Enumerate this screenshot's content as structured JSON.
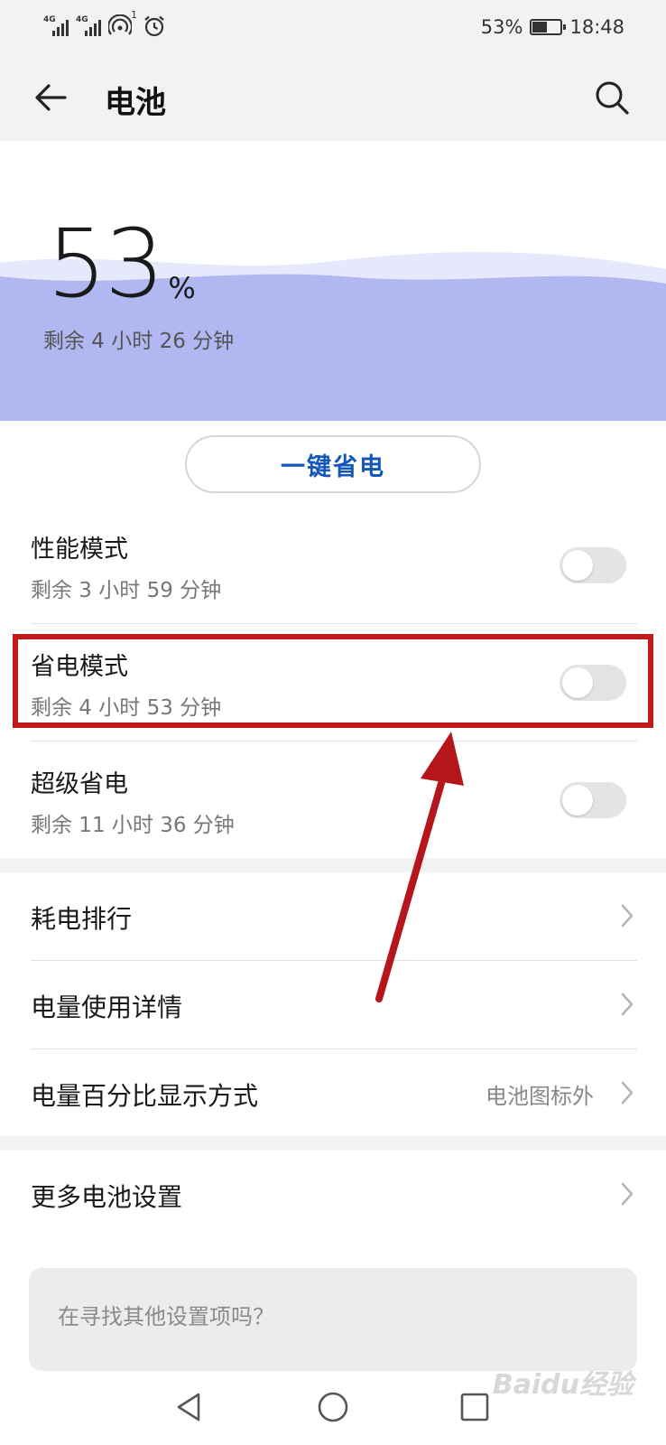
{
  "status_bar": {
    "network_1": "4G",
    "network_2": "4G",
    "hotspot_badge": "1",
    "battery_text": "53%",
    "time": "18:48",
    "battery_level": 0.53,
    "icons": [
      "signal-icon",
      "signal-icon",
      "hotspot-icon",
      "alarm-icon",
      "battery-icon"
    ]
  },
  "header": {
    "title": "电池",
    "back_icon": "back-arrow-icon",
    "search_icon": "search-icon"
  },
  "battery": {
    "percent": "53",
    "percent_sign": "%",
    "remaining": "剩余 4 小时 26 分钟",
    "wave_color": "#b1b7f0"
  },
  "one_key_save": {
    "label": "一键省电"
  },
  "modes": [
    {
      "title": "性能模式",
      "remaining": "剩余 3 小时 59 分钟",
      "enabled": false
    },
    {
      "title": "省电模式",
      "remaining": "剩余 4 小时 53 分钟",
      "enabled": false
    },
    {
      "title": "超级省电",
      "remaining": "剩余 11 小时 36 分钟",
      "enabled": false
    }
  ],
  "settings_list": [
    {
      "title": "耗电排行",
      "value": ""
    },
    {
      "title": "电量使用详情",
      "value": ""
    },
    {
      "title": "电量百分比显示方式",
      "value": "电池图标外"
    }
  ],
  "more": {
    "title": "更多电池设置"
  },
  "search_card": {
    "text": "在寻找其他设置项吗？"
  },
  "nav_bar": {
    "back_icon": "triangle-back-icon",
    "home_icon": "circle-home-icon",
    "recents_icon": "square-recents-icon"
  },
  "watermark": "Baidu经验",
  "colors": {
    "accent": "#1457b7",
    "annotation": "#c01a1a"
  }
}
